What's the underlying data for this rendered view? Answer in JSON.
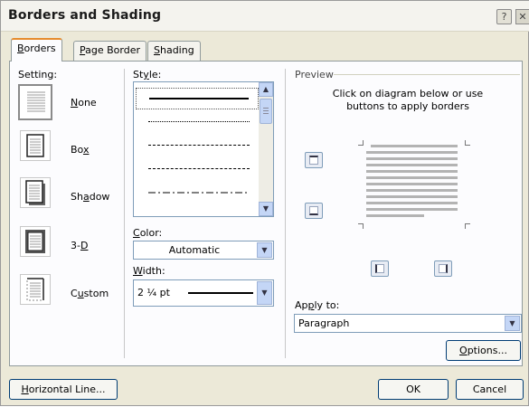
{
  "window": {
    "title": "Borders and Shading",
    "help_label": "?",
    "close_label": "✕"
  },
  "tabs": [
    {
      "label_pre": "",
      "label_key": "B",
      "label_post": "orders"
    },
    {
      "label_pre": "",
      "label_key": "P",
      "label_post": "age Border"
    },
    {
      "label_pre": "",
      "label_key": "S",
      "label_post": "hading"
    }
  ],
  "setting": {
    "heading": "Setting:",
    "items": [
      {
        "label_pre": "",
        "label_key": "N",
        "label_post": "one"
      },
      {
        "label_pre": "Bo",
        "label_key": "x",
        "label_post": ""
      },
      {
        "label_pre": "Sh",
        "label_key": "a",
        "label_post": "dow"
      },
      {
        "label_pre": "3-",
        "label_key": "D",
        "label_post": ""
      },
      {
        "label_pre": "C",
        "label_key": "u",
        "label_post": "stom"
      }
    ]
  },
  "style": {
    "heading_pre": "St",
    "heading_key": "y",
    "heading_post": "le:"
  },
  "color": {
    "heading_pre": "",
    "heading_key": "C",
    "heading_post": "olor:",
    "value": "Automatic"
  },
  "width": {
    "heading_pre": "",
    "heading_key": "W",
    "heading_post": "idth:",
    "value": "2 ¼ pt"
  },
  "preview": {
    "heading": "Preview",
    "instruction_line1": "Click on diagram below or use",
    "instruction_line2": "buttons to apply borders"
  },
  "apply_to": {
    "label_pre": "Ap",
    "label_key": "p",
    "label_post": "ly to:",
    "value": "Paragraph"
  },
  "buttons": {
    "options_pre": "",
    "options_key": "O",
    "options_post": "ptions...",
    "horizontal_pre": "",
    "horizontal_key": "H",
    "horizontal_post": "orizontal Line...",
    "ok": "OK",
    "cancel": "Cancel"
  },
  "colors": {
    "accent_tab": "#e68b2c",
    "dialog_bg": "#ece9d8"
  }
}
